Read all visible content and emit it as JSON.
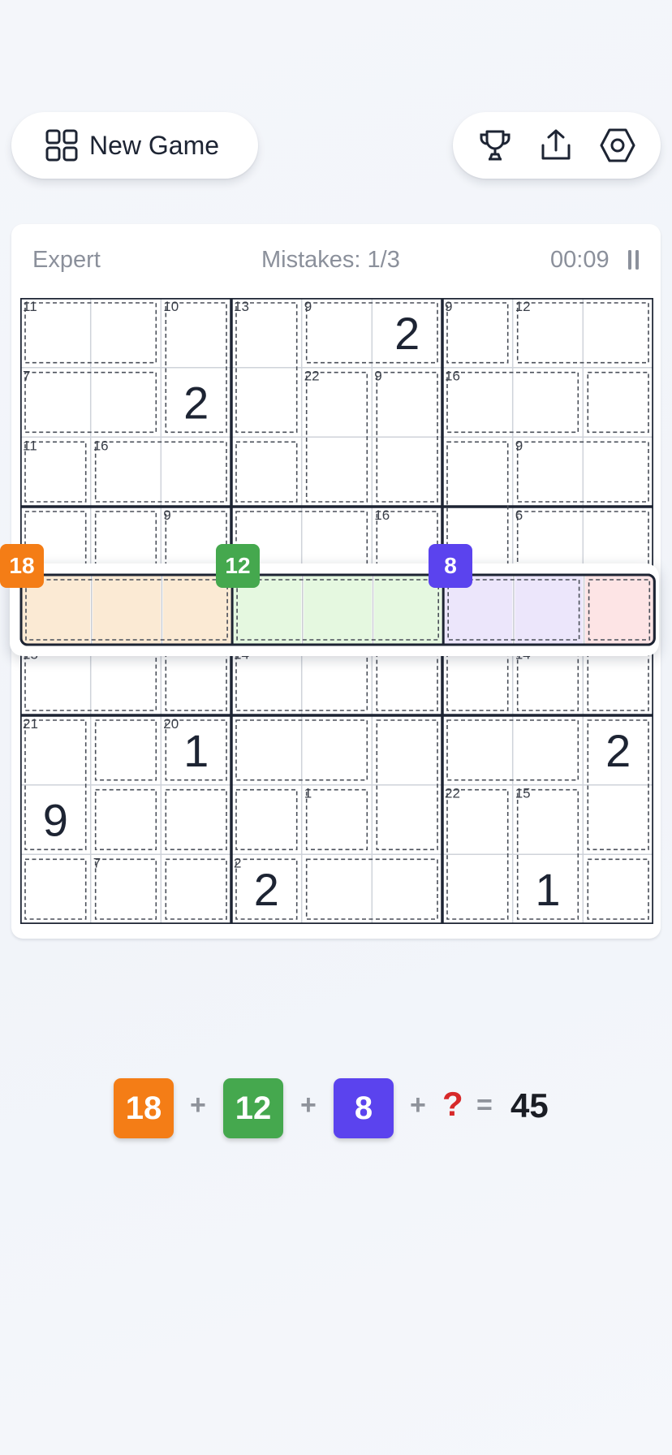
{
  "toolbar": {
    "new_game_label": "New Game",
    "icons": [
      "grid-icon",
      "trophy-icon",
      "share-icon",
      "settings-icon"
    ]
  },
  "header": {
    "difficulty": "Expert",
    "mistakes": "Mistakes: 1/3",
    "timer": "00:09"
  },
  "board": {
    "cage_sums": [
      {
        "row": 0,
        "col": 0,
        "sum": "11"
      },
      {
        "row": 0,
        "col": 2,
        "sum": "10"
      },
      {
        "row": 0,
        "col": 3,
        "sum": "13"
      },
      {
        "row": 0,
        "col": 4,
        "sum": "9"
      },
      {
        "row": 0,
        "col": 6,
        "sum": "9"
      },
      {
        "row": 0,
        "col": 7,
        "sum": "12"
      },
      {
        "row": 1,
        "col": 0,
        "sum": "7"
      },
      {
        "row": 1,
        "col": 4,
        "sum": "22"
      },
      {
        "row": 1,
        "col": 5,
        "sum": "9"
      },
      {
        "row": 1,
        "col": 6,
        "sum": "16"
      },
      {
        "row": 2,
        "col": 0,
        "sum": "11"
      },
      {
        "row": 2,
        "col": 1,
        "sum": "16"
      },
      {
        "row": 2,
        "col": 7,
        "sum": "9"
      },
      {
        "row": 3,
        "col": 2,
        "sum": "9"
      },
      {
        "row": 3,
        "col": 5,
        "sum": "16"
      },
      {
        "row": 3,
        "col": 7,
        "sum": "6"
      },
      {
        "row": 5,
        "col": 0,
        "sum": "15"
      },
      {
        "row": 5,
        "col": 3,
        "sum": "14"
      },
      {
        "row": 5,
        "col": 7,
        "sum": "14"
      },
      {
        "row": 6,
        "col": 0,
        "sum": "21"
      },
      {
        "row": 6,
        "col": 2,
        "sum": "20"
      },
      {
        "row": 7,
        "col": 4,
        "sum": "1"
      },
      {
        "row": 7,
        "col": 6,
        "sum": "22"
      },
      {
        "row": 7,
        "col": 7,
        "sum": "15"
      },
      {
        "row": 8,
        "col": 1,
        "sum": "7"
      },
      {
        "row": 8,
        "col": 3,
        "sum": "2"
      }
    ],
    "digits": [
      {
        "row": 0,
        "col": 5,
        "value": "2"
      },
      {
        "row": 1,
        "col": 2,
        "value": "2"
      },
      {
        "row": 6,
        "col": 2,
        "value": "1"
      },
      {
        "row": 6,
        "col": 8,
        "value": "2"
      },
      {
        "row": 7,
        "col": 0,
        "value": "9"
      },
      {
        "row": 8,
        "col": 3,
        "value": "2"
      },
      {
        "row": 8,
        "col": 7,
        "value": "1"
      }
    ]
  },
  "highlight_row": {
    "groups": [
      {
        "sum": "18",
        "color": "#f47d16",
        "fill": "#fbead4"
      },
      {
        "sum": "12",
        "color": "#45a84e",
        "fill": "#e5f8e0"
      },
      {
        "sum": "8",
        "color": "#5b43ee",
        "fill": "#ece6fb"
      }
    ],
    "unknown_fill": "#fde4e5"
  },
  "equation": {
    "terms": [
      "18",
      "12",
      "8"
    ],
    "plus": "+",
    "equals": "=",
    "unknown": "?",
    "result": "45"
  }
}
